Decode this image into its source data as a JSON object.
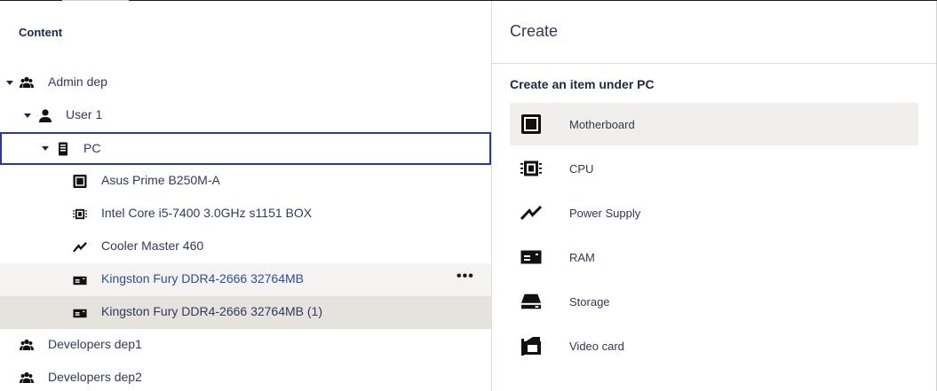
{
  "tree": {
    "header": "Content",
    "rows": [
      {
        "label": "Admin dep",
        "icon": "group-icon"
      },
      {
        "label": "User 1",
        "icon": "user-icon"
      },
      {
        "label": "PC",
        "icon": "pc-tower-icon"
      },
      {
        "label": "Asus Prime B250M-A",
        "icon": "motherboard-icon"
      },
      {
        "label": "Intel Core i5-7400 3.0GHz s1151 BOX",
        "icon": "cpu-icon"
      },
      {
        "label": "Cooler Master 460",
        "icon": "power-supply-icon"
      },
      {
        "label": "Kingston Fury DDR4-2666 32764MB",
        "icon": "ram-icon"
      },
      {
        "label": "Kingston Fury DDR4-2666 32764MB (1)",
        "icon": "ram-icon"
      },
      {
        "label": "Developers dep1",
        "icon": "group-icon"
      },
      {
        "label": "Developers dep2",
        "icon": "group-icon"
      }
    ],
    "more_label": "•••"
  },
  "create": {
    "title": "Create",
    "subtitle": "Create an item under PC",
    "items": [
      {
        "label": "Motherboard",
        "icon": "motherboard-icon"
      },
      {
        "label": "CPU",
        "icon": "cpu-icon"
      },
      {
        "label": "Power Supply",
        "icon": "power-supply-icon"
      },
      {
        "label": "RAM",
        "icon": "ram-icon"
      },
      {
        "label": "Storage",
        "icon": "storage-icon"
      },
      {
        "label": "Video card",
        "icon": "video-card-icon"
      }
    ]
  },
  "colors": {
    "selected_border": "#2b3a9a",
    "link_text": "#2f4d9c",
    "active_row": "#e6e2de",
    "hover_row": "#f4f3f2"
  }
}
